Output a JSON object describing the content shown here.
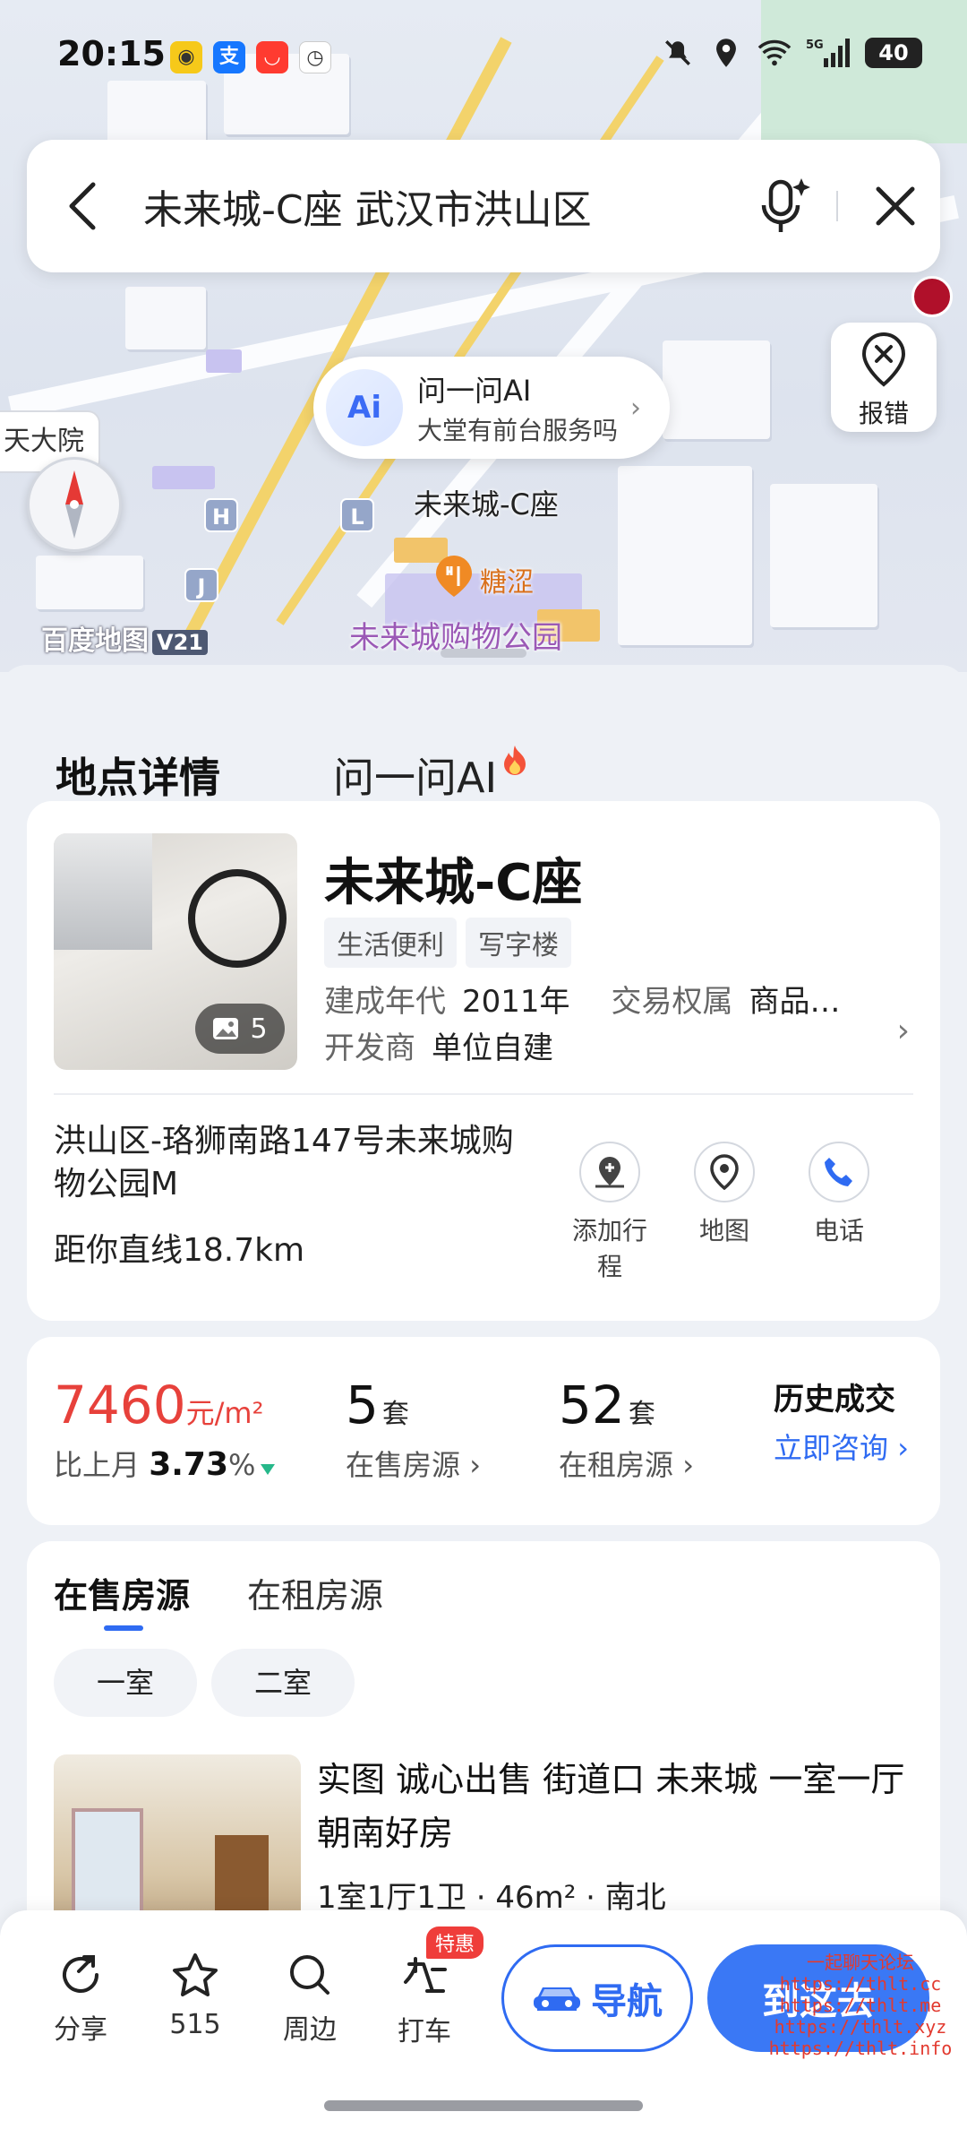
{
  "status_bar": {
    "time": "20:15",
    "network": "5G",
    "battery": "40"
  },
  "search": {
    "query": "未来城-C座 武汉市洪山区"
  },
  "map": {
    "report_label": "报错",
    "ai_bubble": {
      "logo": "Ai",
      "title": "问一问AI",
      "subtitle": "大堂有前台服务吗"
    },
    "left_label": "天大院",
    "poi_selected": "未来城-C座",
    "poi_shop": "糖涩",
    "poi_mall": "未来城购物公园",
    "logo": "百度地图",
    "logo_version": "V21",
    "markers": [
      "H",
      "L",
      "J"
    ]
  },
  "tabs": [
    {
      "label": "地点详情",
      "active": true
    },
    {
      "label": "问一问AI",
      "active": false
    }
  ],
  "place": {
    "name": "未来城-C座",
    "photo_count": "5",
    "tags": [
      "生活便利",
      "写字楼"
    ],
    "built_year_label": "建成年代",
    "built_year": "2011年",
    "ownership_label": "交易权属",
    "ownership": "商品…",
    "developer_label": "开发商",
    "developer": "单位自建",
    "address": "洪山区-珞狮南路147号未来城购物公园M",
    "distance": "距你直线18.7km",
    "actions": [
      {
        "label": "添加行程",
        "icon": "add-trip-icon"
      },
      {
        "label": "地图",
        "icon": "map-pin-icon"
      },
      {
        "label": "电话",
        "icon": "phone-icon"
      }
    ]
  },
  "stats": {
    "price": "7460",
    "price_unit": "元/m²",
    "change_label": "比上月",
    "change_value": "3.73",
    "change_unit": "%",
    "sale_count": "5",
    "sale_unit": "套",
    "sale_label": "在售房源",
    "rent_count": "52",
    "rent_unit": "套",
    "rent_label": "在租房源",
    "history_label": "历史成交",
    "history_link": "立即咨询"
  },
  "listings": {
    "tabs": [
      "在售房源",
      "在租房源"
    ],
    "chips": [
      "一室",
      "二室"
    ],
    "item": {
      "title": "实图 诚心出售 街道口 未来城 一室一厅朝南好房",
      "spec": "1室1厅1卫 · 46m² · 南北"
    }
  },
  "bottom_bar": {
    "share": "分享",
    "favorite_count": "515",
    "nearby": "周边",
    "taxi": "打车",
    "taxi_badge": "特惠",
    "navigate": "导航",
    "go_here": "到这去"
  },
  "watermark": {
    "title": "一起聊天论坛",
    "urls": [
      "https://thlt.cc",
      "https://thlt.me",
      "https://thlt.xyz",
      "https://thlt.info"
    ]
  },
  "colors": {
    "accent": "#2f6bf2",
    "price": "#e7413b",
    "trend_down": "#26b88a",
    "tag_bg": "#f1f3f7"
  }
}
